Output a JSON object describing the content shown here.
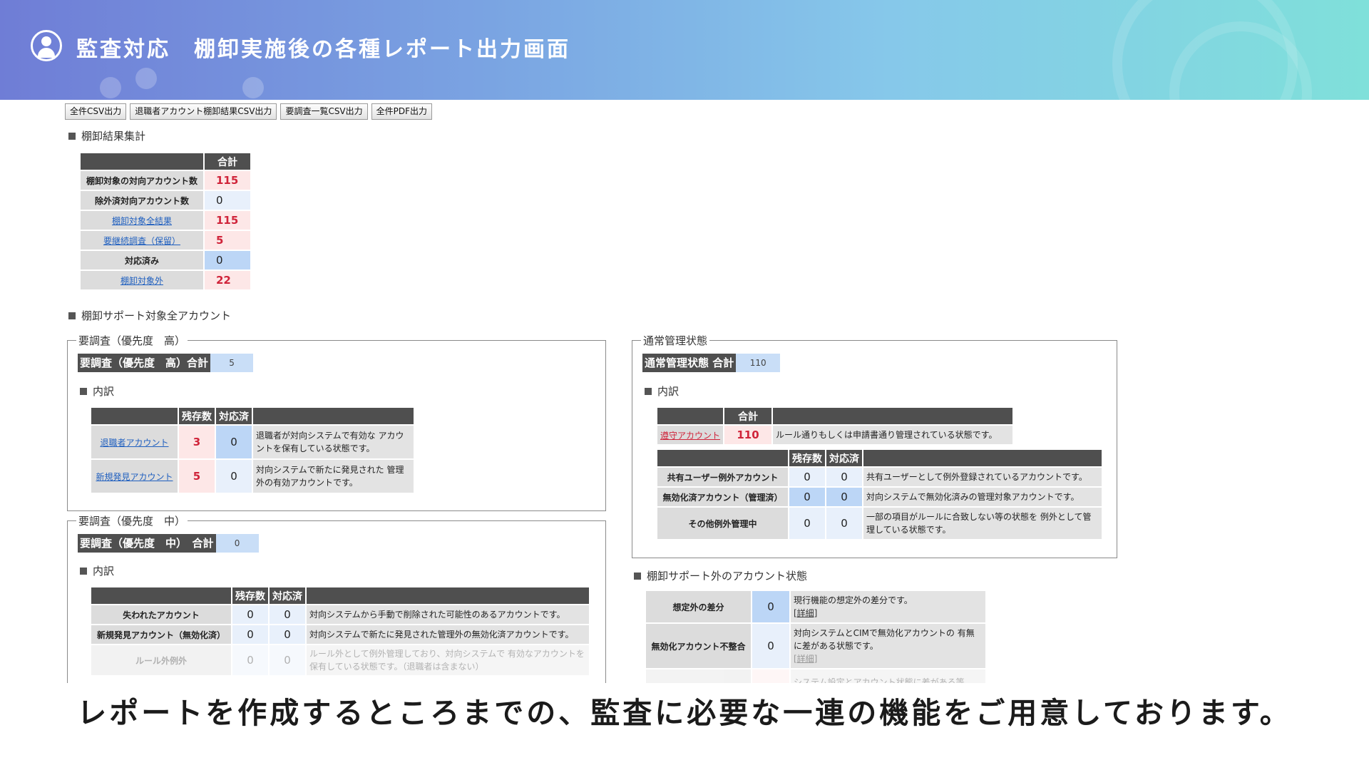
{
  "header": {
    "title": "監査対応　棚卸実施後の各種レポート出力画面"
  },
  "toolbar": {
    "buttons": [
      "全件CSV出力",
      "退職者アカウント棚卸結果CSV出力",
      "要調査一覧CSV出力",
      "全件PDF出力"
    ]
  },
  "summary": {
    "heading": "棚卸結果集計",
    "total_header": "合計",
    "rows": [
      {
        "label": "棚卸対象の対向アカウント数",
        "value": "115"
      },
      {
        "label": "除外済対向アカウント数",
        "value": "0"
      },
      {
        "label": "棚卸対象全結果",
        "value": "115"
      },
      {
        "label": "要継続調査（保留）",
        "value": "5"
      },
      {
        "label": "対応済み",
        "value": "0"
      },
      {
        "label": "棚卸対象外",
        "value": "22"
      }
    ]
  },
  "support": {
    "heading": "棚卸サポート対象全アカウント"
  },
  "high": {
    "legend": "要調査（優先度　高）",
    "total_label": "要調査（優先度　高）合計",
    "total_value": "5",
    "breakdown": "内訳",
    "col_remaining": "残存数",
    "col_done": "対応済",
    "rows": [
      {
        "label": "退職者アカウント",
        "remaining": "3",
        "done": "0",
        "desc": "退職者が対向システムで有効な アカウントを保有している状態です。"
      },
      {
        "label": "新規発見アカウント",
        "remaining": "5",
        "done": "0",
        "desc": "対向システムで新たに発見された 管理外の有効アカウントです。"
      }
    ]
  },
  "mid": {
    "legend": "要調査（優先度　中）",
    "total_label": "要調査（優先度　中）　合計",
    "total_value": "0",
    "breakdown": "内訳",
    "col_remaining": "残存数",
    "col_done": "対応済",
    "rows": [
      {
        "label": "失われたアカウント",
        "remaining": "0",
        "done": "0",
        "desc": "対向システムから手動で削除された可能性のあるアカウントです。"
      },
      {
        "label": "新規発見アカウント（無効化済）",
        "remaining": "0",
        "done": "0",
        "desc": "対向システムで新たに発見された管理外の無効化済アカウントです。"
      },
      {
        "label": "ルール外例外",
        "remaining": "0",
        "done": "0",
        "desc": "ルール外として例外管理しており、対向システムで 有効なアカウントを保有している状態です。（退職者は含まない）"
      }
    ]
  },
  "normal": {
    "legend": "通常管理状態",
    "total_label": "通常管理状態 合計",
    "total_value": "110",
    "breakdown": "内訳",
    "total_header": "合計",
    "compliant": {
      "label": "遵守アカウント",
      "value": "110",
      "desc": "ルール通りもしくは申請書通り管理されている状態です。"
    },
    "col_remaining": "残存数",
    "col_done": "対応済",
    "rows": [
      {
        "label": "共有ユーザー例外アカウント",
        "remaining": "0",
        "done": "0",
        "desc": "共有ユーザーとして例外登録されているアカウントです。"
      },
      {
        "label": "無効化済アカウント（管理済）",
        "remaining": "0",
        "done": "0",
        "desc": "対向システムで無効化済みの管理対象アカウントです。"
      },
      {
        "label": "その他例外管理中",
        "remaining": "0",
        "done": "0",
        "desc": "一部の項目がルールに合致しない等の状態を 例外として管理している状態です。"
      }
    ]
  },
  "outside": {
    "heading": "棚卸サポート外のアカウント状態",
    "rows": [
      {
        "label": "想定外の差分",
        "value": "0",
        "desc": "現行機能の想定外の差分です。",
        "detail": "[詳細]"
      },
      {
        "label": "無効化アカウント不整合",
        "value": "0",
        "desc": "対向システムとCIMで無効化アカウントの 有無に差がある状態です。",
        "detail": "[詳細]"
      },
      {
        "label": "",
        "value": "",
        "desc": "システム設定とアカウント状態に差がある等",
        "detail": ""
      }
    ]
  },
  "caption": "レポートを作成するところまでの、監査に必要な一連の機能をご用意しております。"
}
